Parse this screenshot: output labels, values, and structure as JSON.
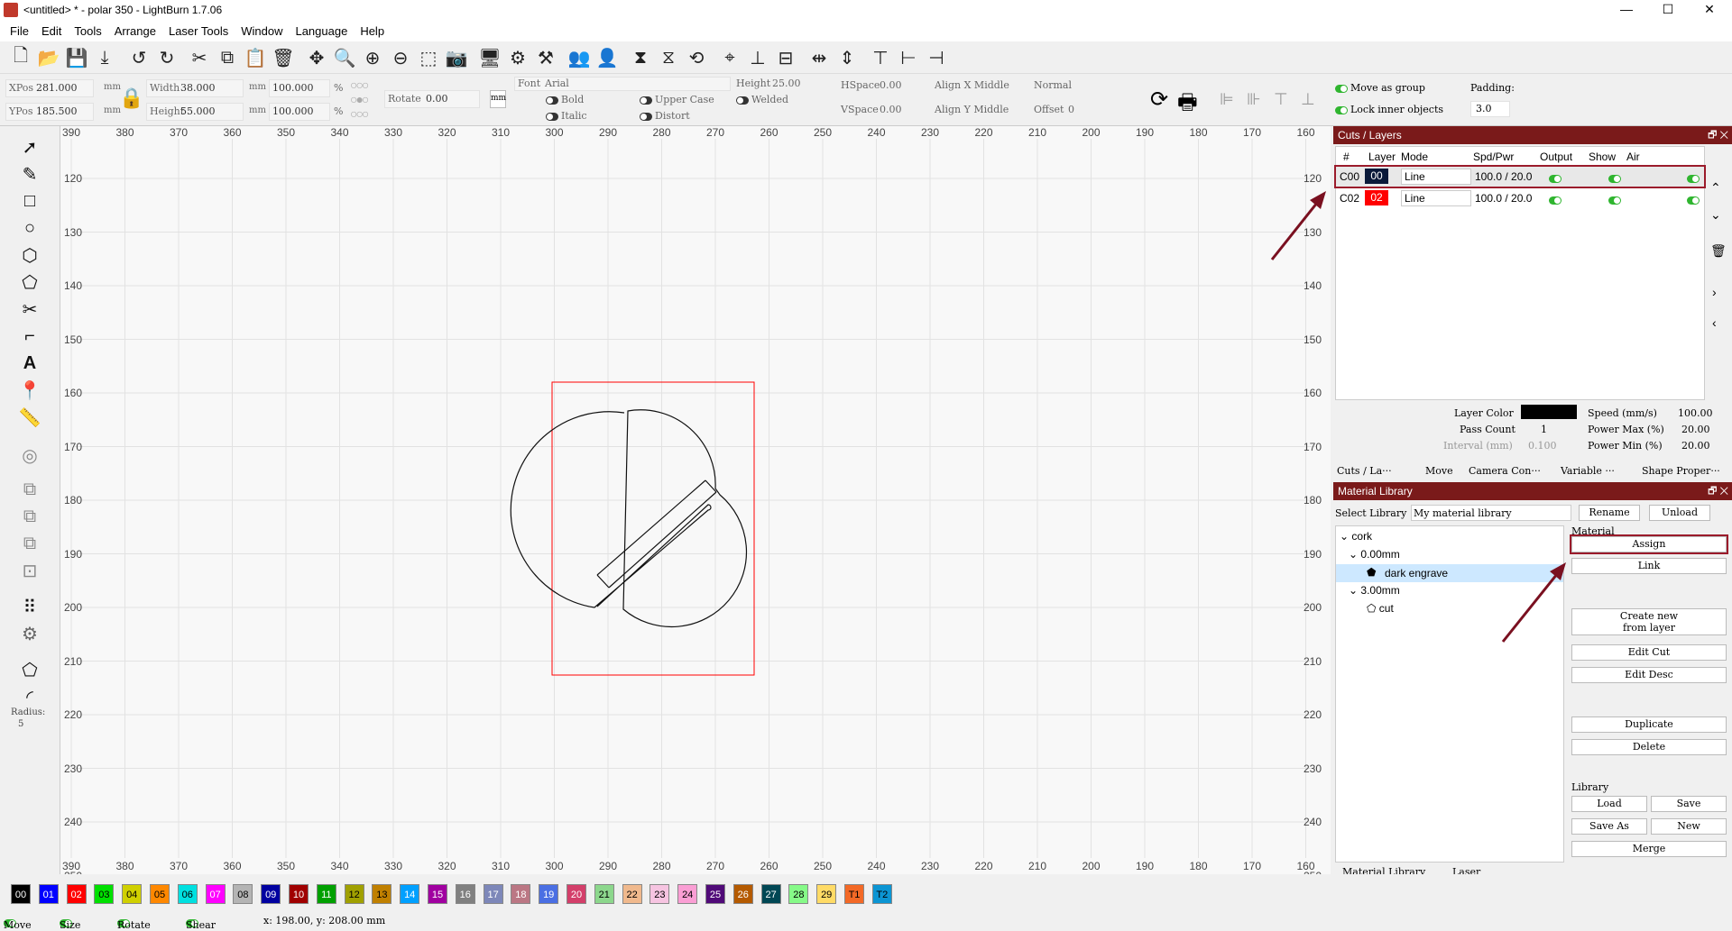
{
  "window": {
    "title": "<untitled> * - polar 350 - LightBurn 1.7.06",
    "minimize": "—",
    "maximize": "☐",
    "close": "✕"
  },
  "menu": [
    "File",
    "Edit",
    "Tools",
    "Arrange",
    "Laser Tools",
    "Window",
    "Language",
    "Help"
  ],
  "props": {
    "xpos_label": "XPos",
    "xpos": "281.000",
    "ypos_label": "YPos",
    "ypos": "185.500",
    "unit": "mm",
    "width_label": "Width",
    "width": "38.000",
    "height_label": "Height",
    "height": "55.000",
    "scale_w": "100.000",
    "scale_h": "100.000",
    "percent": "%",
    "rotate_label": "Rotate",
    "rotate": "0.00",
    "mm_btn": "mm",
    "font_label": "Font",
    "font": "Arial",
    "text_height_label": "Height",
    "text_height": "25.00",
    "hspace_label": "HSpace",
    "hspace": "0.00",
    "vspace_label": "VSpace",
    "vspace": "0.00",
    "align_x": "Align X Middle",
    "align_y": "Align Y Middle",
    "normal": "Normal",
    "offset_label": "Offset",
    "offset": "0",
    "bold": "Bold",
    "italic": "Italic",
    "upper_case": "Upper Case",
    "distort": "Distort",
    "welded": "Welded",
    "move_as_group": "Move as group",
    "lock_inner": "Lock inner objects",
    "padding_label": "Padding:",
    "padding": "3.0"
  },
  "toolbox": {
    "radius_label": "Radius:",
    "radius": "5"
  },
  "rulers": {
    "x": [
      "390",
      "380",
      "370",
      "360",
      "350",
      "340",
      "330",
      "320",
      "310",
      "300",
      "290",
      "280",
      "270",
      "260",
      "250",
      "240",
      "230",
      "220",
      "210",
      "200",
      "190",
      "180",
      "170",
      "160"
    ],
    "y": [
      "120",
      "130",
      "140",
      "150",
      "160",
      "170",
      "180",
      "190",
      "200",
      "210",
      "220",
      "230",
      "240",
      "250"
    ]
  },
  "palette": [
    {
      "label": "00",
      "color": "#000000",
      "text": "#ffffff"
    },
    {
      "label": "01",
      "color": "#0000ff",
      "text": "#ffffff"
    },
    {
      "label": "02",
      "color": "#ff0000",
      "text": "#ffffff"
    },
    {
      "label": "03",
      "color": "#00e000",
      "text": "#000000"
    },
    {
      "label": "04",
      "color": "#d0d000",
      "text": "#000000"
    },
    {
      "label": "05",
      "color": "#ff8800",
      "text": "#000000"
    },
    {
      "label": "06",
      "color": "#00e0e0",
      "text": "#000000"
    },
    {
      "label": "07",
      "color": "#ff00ff",
      "text": "#ffffff"
    },
    {
      "label": "08",
      "color": "#b4b4b4",
      "text": "#000000"
    },
    {
      "label": "09",
      "color": "#0000a0",
      "text": "#ffffff"
    },
    {
      "label": "10",
      "color": "#a00000",
      "text": "#ffffff"
    },
    {
      "label": "11",
      "color": "#00a000",
      "text": "#ffffff"
    },
    {
      "label": "12",
      "color": "#a0a000",
      "text": "#000000"
    },
    {
      "label": "13",
      "color": "#c08000",
      "text": "#000000"
    },
    {
      "label": "14",
      "color": "#00a0ff",
      "text": "#ffffff"
    },
    {
      "label": "15",
      "color": "#a000a0",
      "text": "#ffffff"
    },
    {
      "label": "16",
      "color": "#808080",
      "text": "#ffffff"
    },
    {
      "label": "17",
      "color": "#7d87b9",
      "text": "#ffffff"
    },
    {
      "label": "18",
      "color": "#bb7784",
      "text": "#ffffff"
    },
    {
      "label": "19",
      "color": "#4a6fe3",
      "text": "#ffffff"
    },
    {
      "label": "20",
      "color": "#d33f6a",
      "text": "#ffffff"
    },
    {
      "label": "21",
      "color": "#8cd78c",
      "text": "#000000"
    },
    {
      "label": "22",
      "color": "#f0b98d",
      "text": "#000000"
    },
    {
      "label": "23",
      "color": "#f6c4e1",
      "text": "#000000"
    },
    {
      "label": "24",
      "color": "#fa9ed4",
      "text": "#000000"
    },
    {
      "label": "25",
      "color": "#500a78",
      "text": "#ffffff"
    },
    {
      "label": "26",
      "color": "#b45a00",
      "text": "#ffffff"
    },
    {
      "label": "27",
      "color": "#004754",
      "text": "#ffffff"
    },
    {
      "label": "28",
      "color": "#86fa88",
      "text": "#000000"
    },
    {
      "label": "29",
      "color": "#ffdb66",
      "text": "#000000"
    },
    {
      "label": "T1",
      "color": "#f36926",
      "text": "#000000"
    },
    {
      "label": "T2",
      "color": "#0c95d3",
      "text": "#000000"
    }
  ],
  "status": {
    "move": "Move",
    "size": "Size",
    "rotate": "Rotate",
    "shear": "Shear",
    "coords": "x: 198.00, y: 208.00 mm"
  },
  "cuts": {
    "title": "Cuts / Layers",
    "headers": [
      "#",
      "Layer",
      "Mode",
      "Spd/Pwr",
      "Output",
      "Show",
      "Air"
    ],
    "rows": [
      {
        "id": "C00",
        "layer": "00",
        "color": "#0a1a3a",
        "mode": "Line",
        "spdpwr": "100.0 / 20.0"
      },
      {
        "id": "C02",
        "layer": "02",
        "color": "#ff0000",
        "mode": "Line",
        "spdpwr": "100.0 / 20.0"
      }
    ],
    "layer_color_label": "Layer Color",
    "pass_count_label": "Pass Count",
    "pass_count": "1",
    "interval_label": "Interval (mm)",
    "interval": "0.100",
    "speed_label": "Speed (mm/s)",
    "speed": "100.00",
    "power_max_label": "Power Max (%)",
    "power_max": "20.00",
    "power_min_label": "Power Min (%)",
    "power_min": "20.00",
    "tabs": [
      "Cuts / La···",
      "Move",
      "Camera Con···",
      "Variable ···",
      "Shape Proper···"
    ]
  },
  "material": {
    "title": "Material Library",
    "select_label": "Select Library",
    "library": "My material library",
    "rename": "Rename",
    "unload": "Unload",
    "material_label": "Material",
    "tree": [
      {
        "label": "cork",
        "level": 0
      },
      {
        "label": "0.00mm",
        "level": 1
      },
      {
        "label": "dark engrave",
        "level": 2
      },
      {
        "label": "3.00mm",
        "level": 1
      },
      {
        "label": "cut",
        "level": 2
      }
    ],
    "assign": "Assign",
    "link": "Link",
    "create_new_1": "Create new",
    "create_new_2": "from layer",
    "edit_cut": "Edit Cut",
    "edit_desc": "Edit Desc",
    "duplicate": "Duplicate",
    "delete": "Delete",
    "library_label": "Library",
    "load": "Load",
    "save": "Save",
    "save_as": "Save As",
    "new": "New",
    "merge": "Merge",
    "tabs": [
      "Material Library",
      "Laser"
    ]
  },
  "colors": {
    "accent": "#7a1a1a",
    "highlight": "#9b1b2b",
    "selection": "#cde8ff"
  }
}
